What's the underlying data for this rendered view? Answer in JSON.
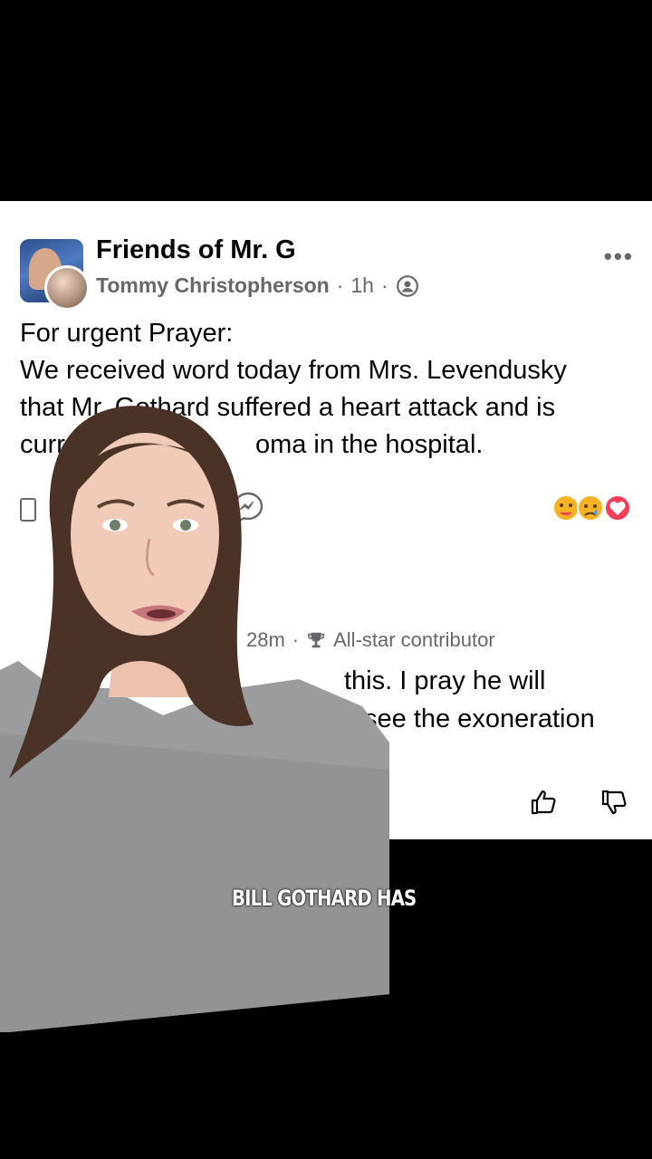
{
  "post": {
    "group_name": "Friends of Mr. G",
    "author": "Tommy Christopherson",
    "separator": "·",
    "time": "1h",
    "more_label": "•••",
    "lines": [
      "For urgent Prayer:",
      "We received word today from Mrs. Levendusky",
      "that Mr. Gothard suffered a heart attack and is",
      "currently in a coma in the hospital."
    ],
    "visible_lines": [
      "For urgent Prayer:",
      "We received word today from Mrs. Levendusky",
      "that Mr. Gothard suffered a heart attack and is",
      "curr",
      "oma in the hospital."
    ],
    "reaction_icons": [
      "care-reaction",
      "sad-reaction",
      "love-reaction"
    ]
  },
  "comment": {
    "time": "28m",
    "badge": "All-star contributor",
    "line1": "this. I pray he will",
    "line2": "see the exoneration"
  },
  "video": {
    "caption": "BILL GOTHARD HAS"
  },
  "colors": {
    "text": "#050505",
    "meta": "#65676b",
    "background": "#000000",
    "card": "#ffffff",
    "love": "#f33e58",
    "reaction_yellow": "#f7b125"
  }
}
